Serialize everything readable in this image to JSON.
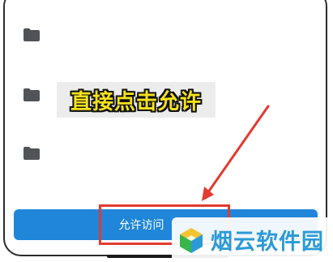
{
  "caption": {
    "text": "直接点击允许",
    "color": "#f5e11c"
  },
  "folders": [
    {
      "icon": "folder-icon"
    },
    {
      "icon": "folder-icon"
    },
    {
      "icon": "folder-icon"
    }
  ],
  "allow_button": {
    "label": "允许访问",
    "color": "#1f86d9"
  },
  "highlight": {
    "color": "#e23b2f"
  },
  "watermark": {
    "text": "烟云软件园",
    "icon": "cube-logo-icon",
    "color": "#2b9ad6"
  }
}
